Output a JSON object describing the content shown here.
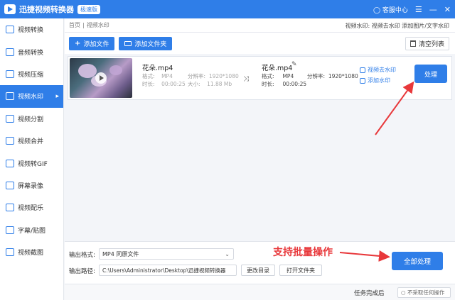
{
  "app": {
    "title": "迅捷视频转换器",
    "badge": "极速版",
    "support": "客服中心",
    "menu_glyph": "☰",
    "min_glyph": "—",
    "close_glyph": "✕"
  },
  "sidebar": {
    "items": [
      {
        "label": "视频转换",
        "icon": "video-convert-icon"
      },
      {
        "label": "音频转换",
        "icon": "audio-convert-icon"
      },
      {
        "label": "视频压缩",
        "icon": "video-compress-icon"
      },
      {
        "label": "视频水印",
        "icon": "video-watermark-icon",
        "active": true
      },
      {
        "label": "视频分割",
        "icon": "video-split-icon"
      },
      {
        "label": "视频合并",
        "icon": "video-merge-icon"
      },
      {
        "label": "视频转GIF",
        "icon": "gif-icon"
      },
      {
        "label": "屏幕录像",
        "icon": "screen-record-icon"
      },
      {
        "label": "视频配乐",
        "icon": "music-icon"
      },
      {
        "label": "字幕/贴图",
        "icon": "subtitle-icon"
      },
      {
        "label": "视频截图",
        "icon": "screenshot-icon"
      }
    ]
  },
  "breadcrumb": {
    "home": "首页",
    "sep": "|",
    "current": "视频水印",
    "right_text": "视频水印: 视频去水印 添加图片/文字水印"
  },
  "toolbar": {
    "add_file": "添加文件",
    "add_folder": "添加文件夹",
    "clear_list": "清空列表"
  },
  "file": {
    "source": {
      "name": "花朵.mp4",
      "format_label": "格式:",
      "format": "MP4",
      "resolution_label": "分辨率:",
      "resolution": "1920*1080",
      "duration_label": "时长:",
      "duration": "00:00:25",
      "size_label": "大小:",
      "size": "11.88 Mb"
    },
    "output": {
      "name": "花朵.mp4",
      "format_label": "格式:",
      "format": "MP4",
      "resolution_label": "分辨率:",
      "resolution": "1920*1080",
      "duration_label": "时长:",
      "duration": "00:00:25"
    },
    "remove_watermark": "视频去水印",
    "add_watermark": "添加水印",
    "process": "处理"
  },
  "output": {
    "format_label": "输出格式:",
    "format_value": "MP4  同原文件",
    "path_label": "输出路径:",
    "path_value": "C:\\Users\\Administrator\\Desktop\\迅捷视频转换器",
    "change_dir": "更改目录",
    "open_folder": "打开文件夹",
    "process_all": "全部处理",
    "annotation": "支持批量操作"
  },
  "status": {
    "task_done_label": "任务完成后",
    "task_done_value": "不采取任何操作"
  },
  "colors": {
    "accent": "#2f7ee8",
    "annotation": "#e8383b"
  }
}
